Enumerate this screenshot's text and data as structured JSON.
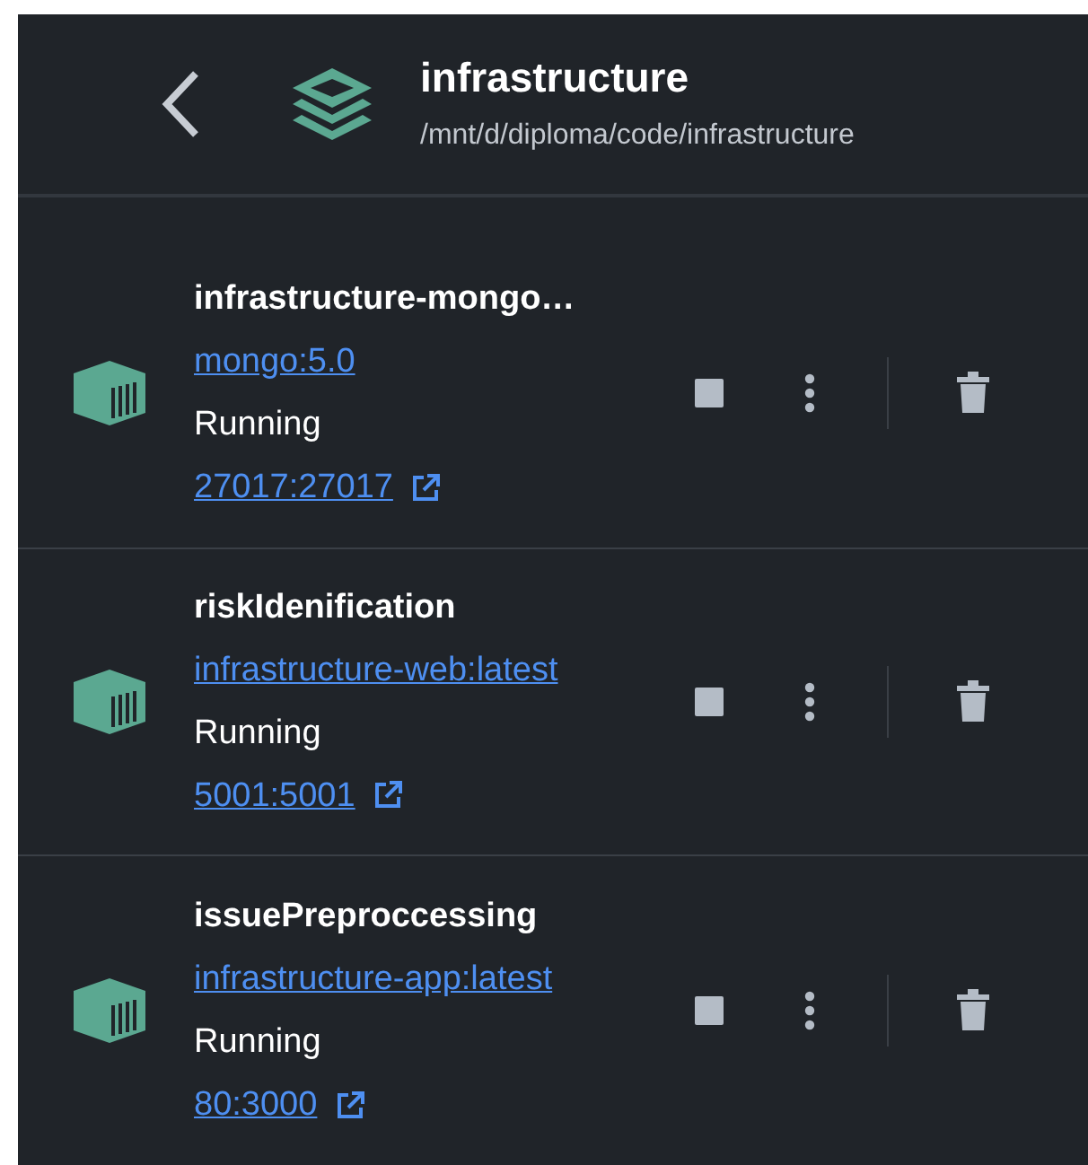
{
  "header": {
    "title": "infrastructure",
    "path": "/mnt/d/diploma/code/infrastructure"
  },
  "containers": [
    {
      "name": "infrastructure-mongo…",
      "image": "mongo:5.0",
      "status": "Running",
      "ports": "27017:27017"
    },
    {
      "name": "riskIdenification",
      "image": "infrastructure-web:latest",
      "status": "Running",
      "ports": "5001:5001"
    },
    {
      "name": "issuePreproccessing",
      "image": "infrastructure-app:latest",
      "status": "Running",
      "ports": "80:3000"
    }
  ]
}
